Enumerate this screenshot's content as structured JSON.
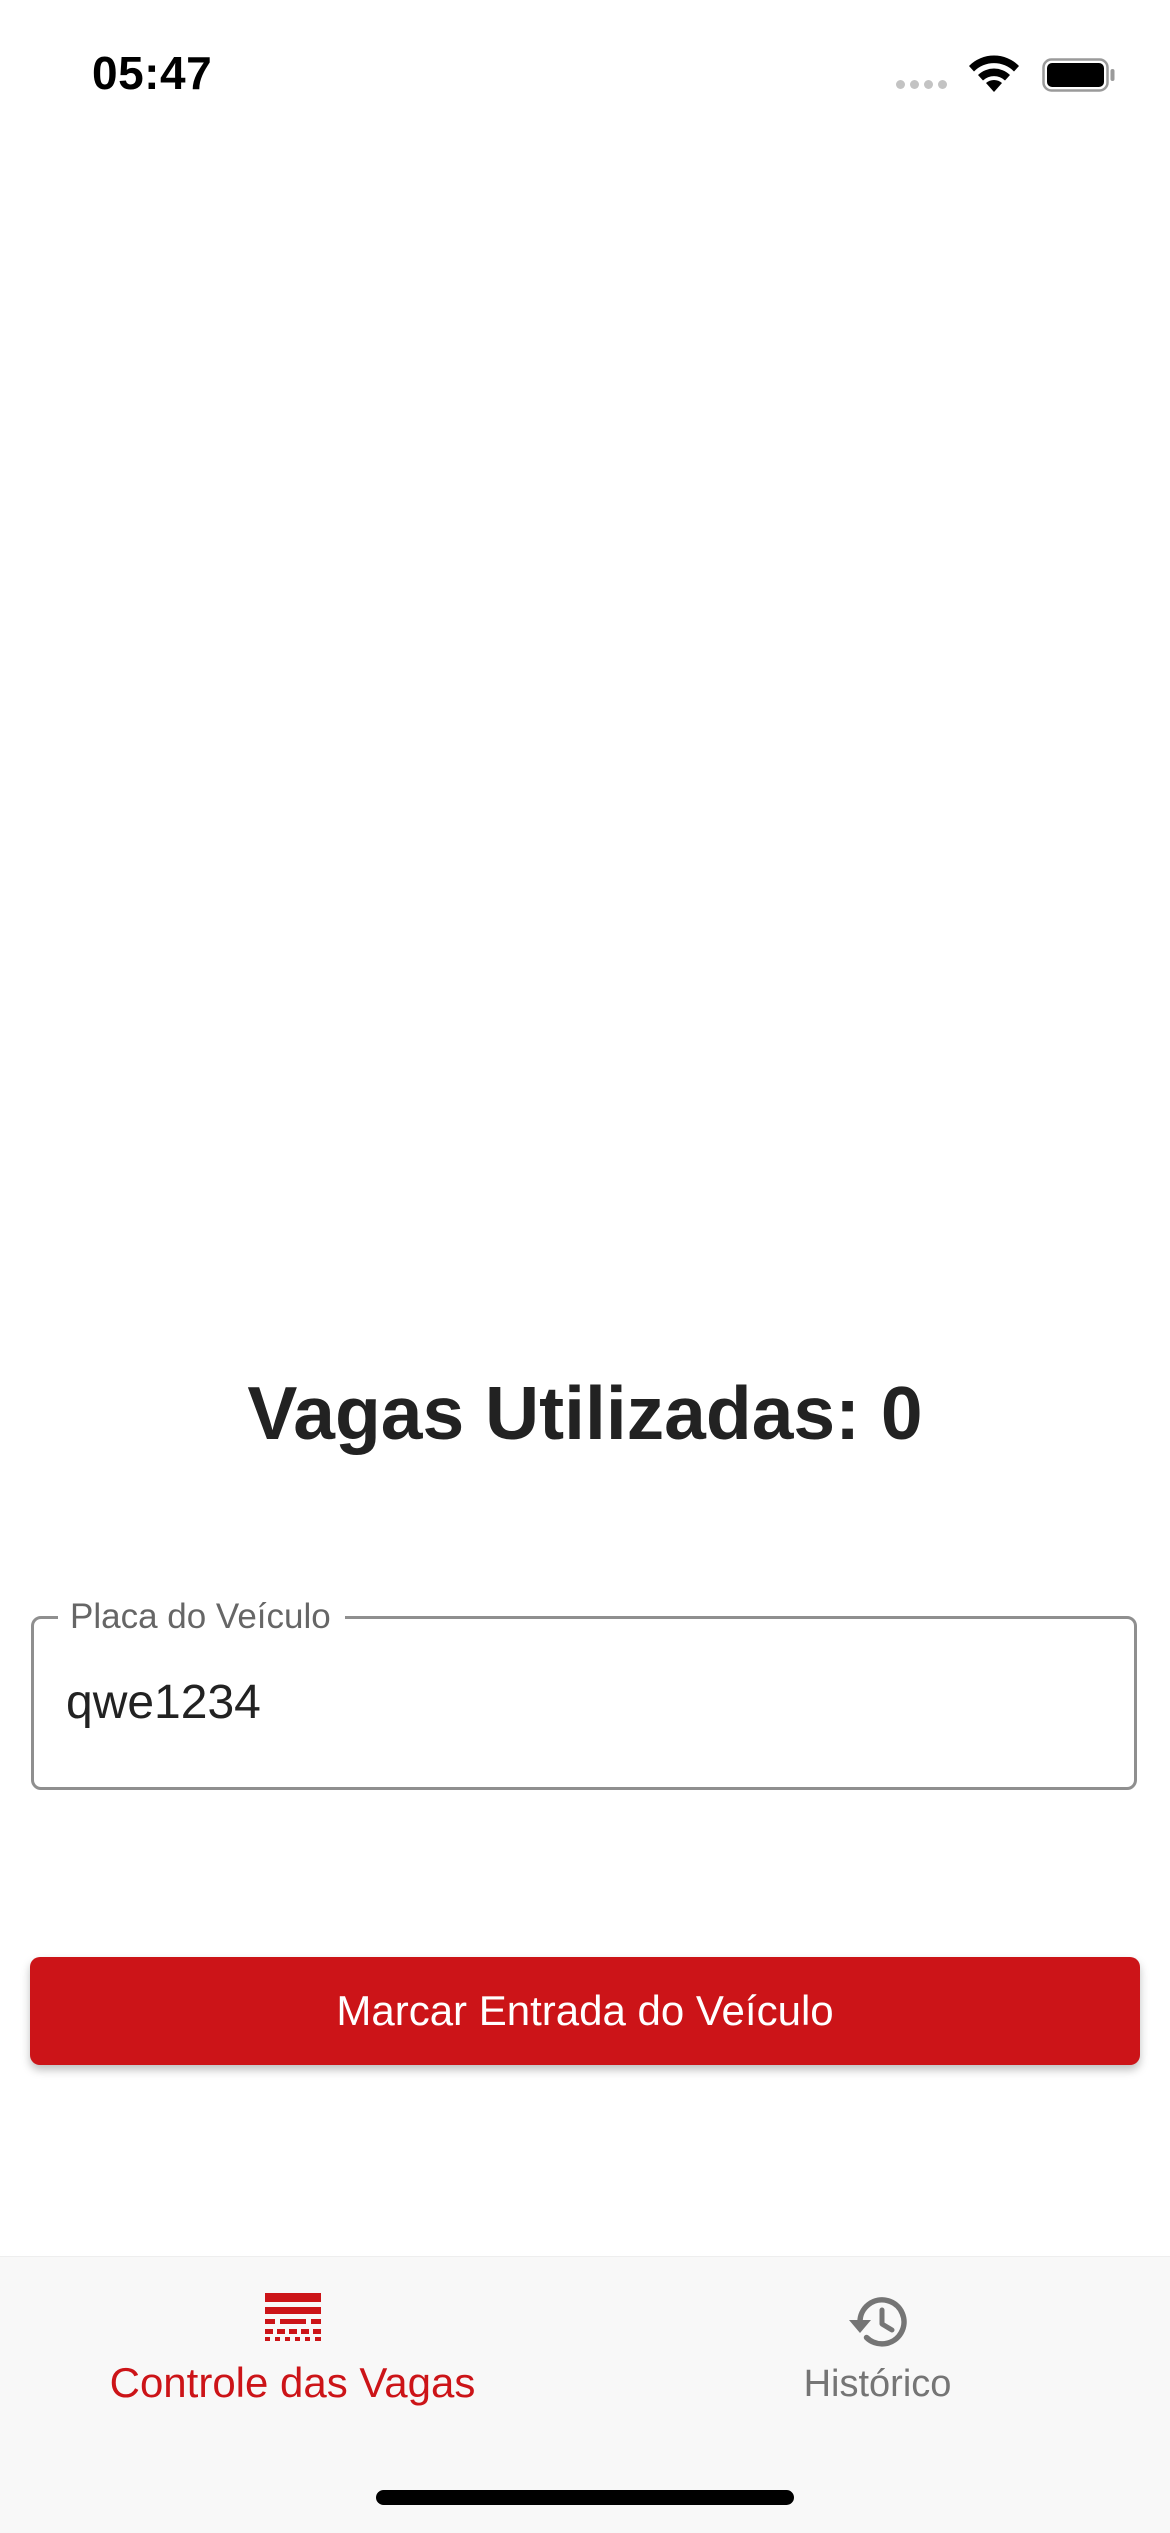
{
  "status_bar": {
    "time": "05:47",
    "icons": [
      "signal-icon",
      "wifi-icon",
      "battery-icon"
    ]
  },
  "main": {
    "counter_title": "Vagas Utilizadas: 0",
    "plate_field": {
      "label": "Placa do Veículo",
      "value": "qwe1234"
    },
    "entry_button_label": "Marcar Entrada do Veículo"
  },
  "tab_bar": {
    "tabs": [
      {
        "label": "Controle das Vagas",
        "icon": "parking-grid-icon",
        "active": true
      },
      {
        "label": "Histórico",
        "icon": "history-icon",
        "active": false
      }
    ]
  },
  "colors": {
    "accent": "#cc1418",
    "inactive": "#757575",
    "tab_bar_background": "#f8f8f8"
  }
}
